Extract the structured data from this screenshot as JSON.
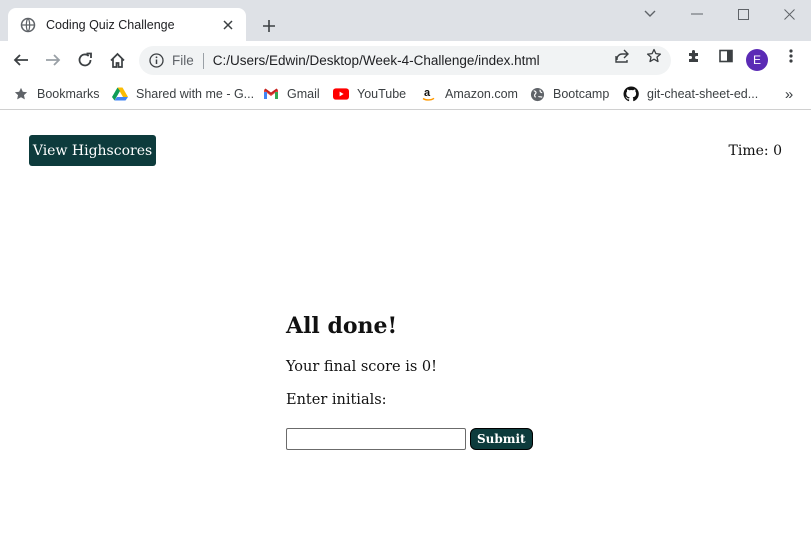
{
  "browser": {
    "tab": {
      "title": "Coding Quiz Challenge",
      "favicon": "globe-icon"
    },
    "omnibox": {
      "scheme": "File",
      "url": "C:/Users/Edwin/Desktop/Week-4-Challenge/index.html"
    },
    "profile_initial": "E",
    "colors": {
      "tabstrip": "#dee1e6",
      "profile": "#5b2bb5"
    }
  },
  "bookmarks": [
    {
      "label": "Bookmarks",
      "icon": "star-icon"
    },
    {
      "label": "Shared with me - G...",
      "icon": "google-drive-icon"
    },
    {
      "label": "Gmail",
      "icon": "gmail-icon"
    },
    {
      "label": "YouTube",
      "icon": "youtube-icon"
    },
    {
      "label": "Amazon.com",
      "icon": "amazon-icon"
    },
    {
      "label": "Bootcamp",
      "icon": "globe-icon"
    },
    {
      "label": "git-cheat-sheet-ed...",
      "icon": "github-icon"
    }
  ],
  "page": {
    "highscores_label": "View Highscores",
    "timer_label": "Time:",
    "timer_value": "0",
    "heading": "All done!",
    "score_text": "Your final score is 0!",
    "initials_label": "Enter initials:",
    "initials_value": "",
    "submit_label": "Submit",
    "accent": "#0d3b3c"
  }
}
